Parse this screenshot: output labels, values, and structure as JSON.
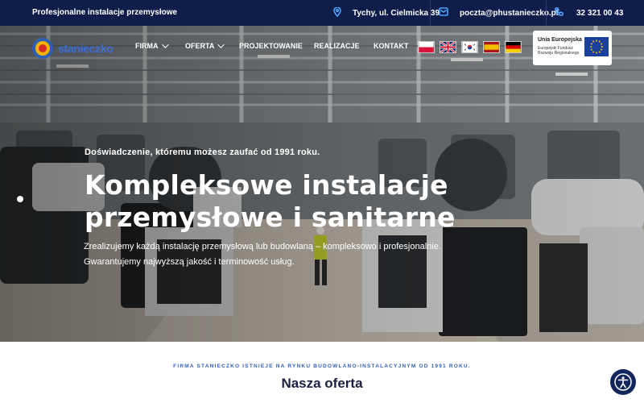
{
  "topbar": {
    "tagline": "Profesjonalne instalacje przemysłowe",
    "address": "Tychy, ul. Cielmicka 39",
    "email": "poczta@phustanieczko.pl",
    "phone": "32 321 00 43",
    "icons": [
      "map-pin-icon",
      "mail-icon",
      "phone-icon"
    ],
    "accent_color": "#4da3ff",
    "background": "#0f1d4a"
  },
  "logo": {
    "text": "stanieczko"
  },
  "nav": {
    "items": [
      {
        "label": "FIRMA",
        "dropdown": true
      },
      {
        "label": "OFERTA",
        "dropdown": true
      },
      {
        "label": "PROJEKTOWANIE",
        "dropdown": false
      },
      {
        "label": "REALIZACJE",
        "dropdown": false
      },
      {
        "label": "KONTAKT",
        "dropdown": false
      }
    ]
  },
  "languages": [
    "Polski",
    "English",
    "한국어",
    "Español",
    "Deutsch"
  ],
  "eu_badge": {
    "title": "Unia Europejska",
    "subtitle": "Europejski Fundusz Rozwoju Regionalnego"
  },
  "hero": {
    "kicker": "Doświadczenie, któremu możesz zaufać od 1991 roku.",
    "title_line1": "Kompleksowe instalacje",
    "title_line2": "przemysłowe i sanitarne",
    "desc_line1": "Zrealizujemy każdą instalację przemysłową lub budowlaną – kompleksowo i profesjonalnie.",
    "desc_line2": "Gwarantujemy najwyższą jakość i terminowość usług."
  },
  "offer_section": {
    "kicker": "FIRMA STANIECZKO ISTNIEJE NA RYNKU BUDOWLANO-INSTALACYJNYM OD 1991 ROKU.",
    "title": "Nasza oferta"
  },
  "accessibility": {
    "icon": "accessibility-icon",
    "color": "#13265c"
  }
}
